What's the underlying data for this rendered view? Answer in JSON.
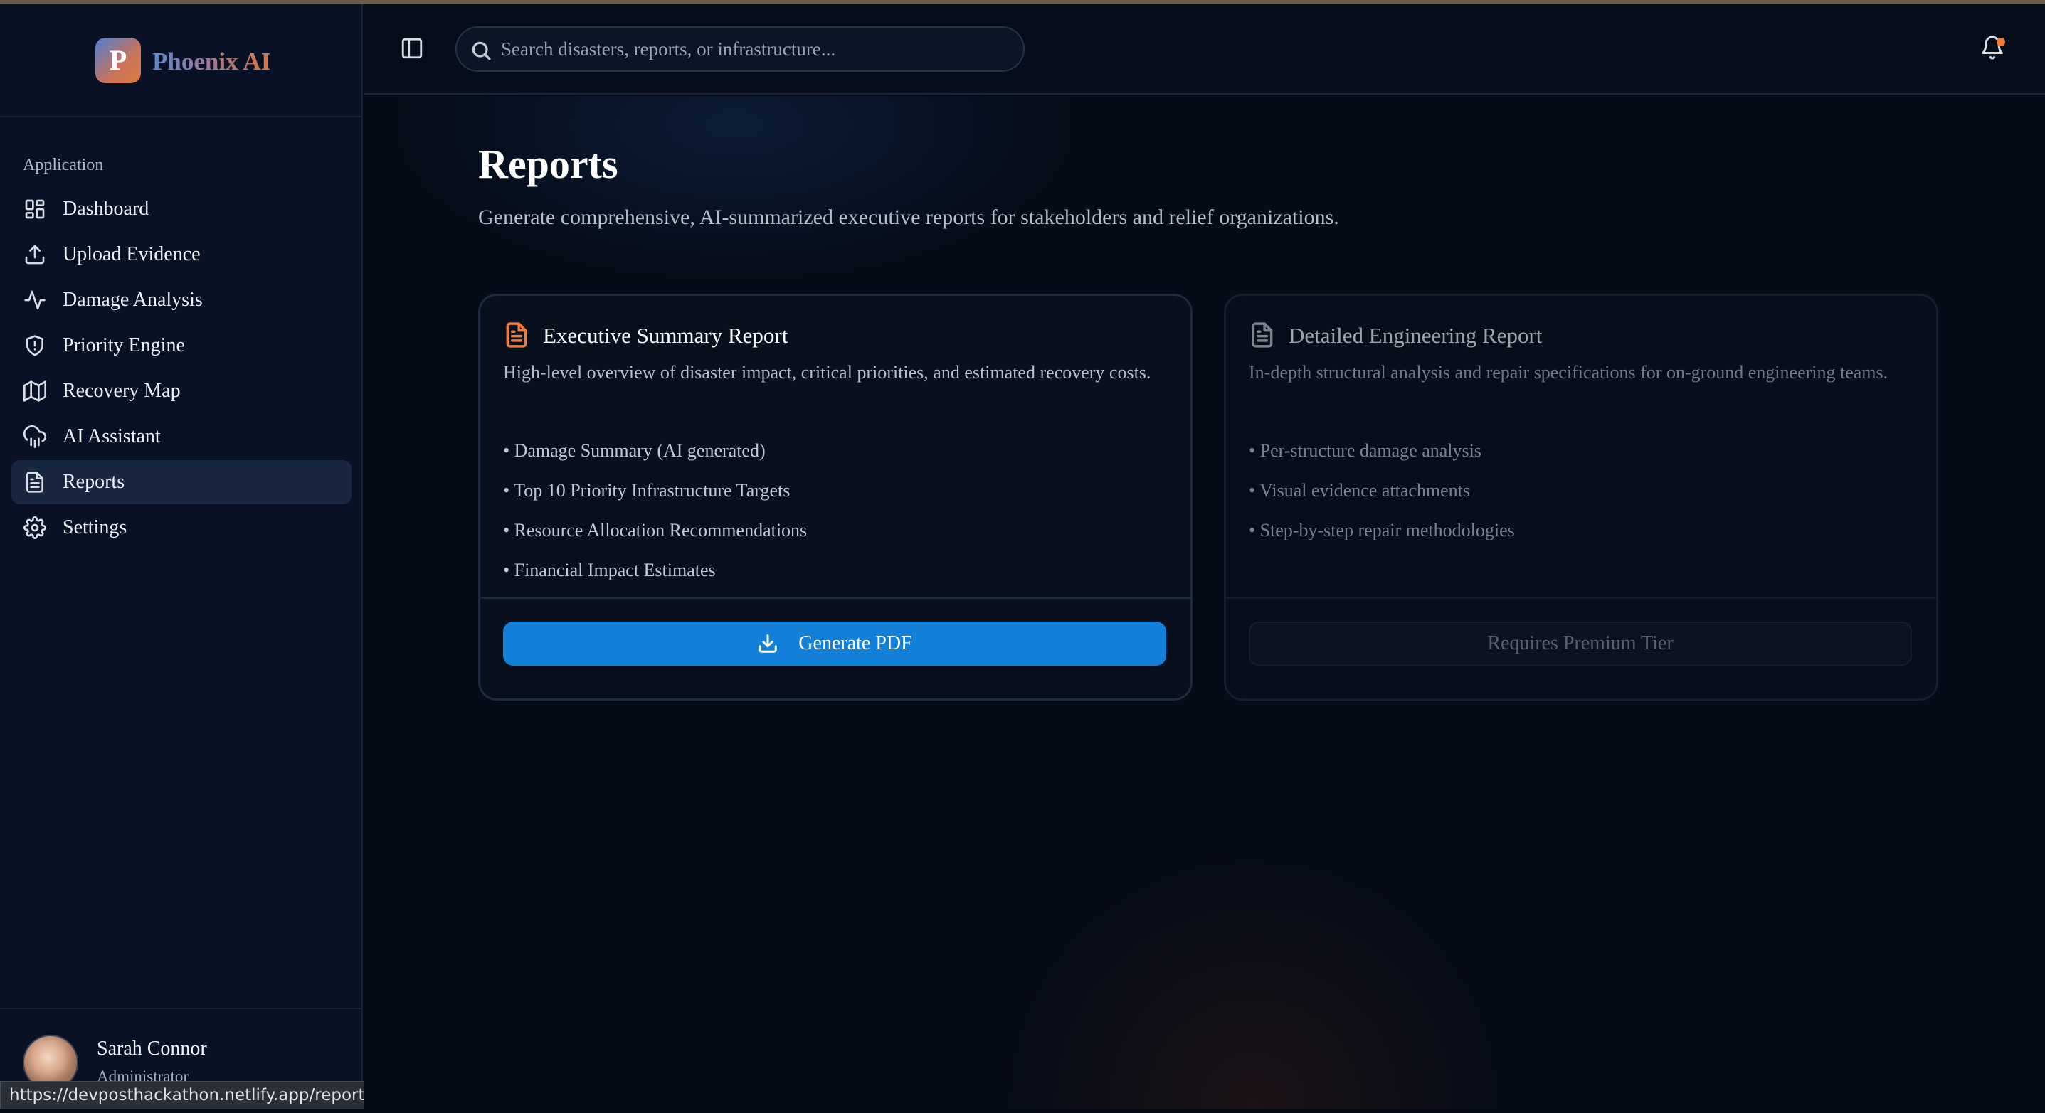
{
  "brand": {
    "logo_letter": "P",
    "name": "Phoenix AI"
  },
  "sidebar": {
    "section_label": "Application",
    "items": [
      {
        "label": "Dashboard",
        "icon": "dashboard-grid-icon"
      },
      {
        "label": "Upload Evidence",
        "icon": "upload-icon"
      },
      {
        "label": "Damage Analysis",
        "icon": "activity-icon"
      },
      {
        "label": "Priority Engine",
        "icon": "shield-icon"
      },
      {
        "label": "Recovery Map",
        "icon": "map-icon"
      },
      {
        "label": "AI Assistant",
        "icon": "cloud-rain-icon"
      },
      {
        "label": "Reports",
        "icon": "file-text-icon",
        "active": true
      },
      {
        "label": "Settings",
        "icon": "gear-icon"
      }
    ]
  },
  "user": {
    "name": "Sarah Connor",
    "role": "Administrator"
  },
  "status_bar": {
    "url": "https://devposthackathon.netlify.app/reports"
  },
  "header": {
    "search_placeholder": "Search disasters, reports, or infrastructure...",
    "notification_badge": true
  },
  "page": {
    "title": "Reports",
    "subtitle": "Generate comprehensive, AI-summarized executive reports for stakeholders and relief organizations."
  },
  "cards": [
    {
      "title": "Executive Summary Report",
      "description": "High-level overview of disaster impact, critical priorities, and estimated recovery costs.",
      "features": [
        "• Damage Summary (AI generated)",
        "• Top 10 Priority Infrastructure Targets",
        "• Resource Allocation Recommendations",
        "• Financial Impact Estimates"
      ],
      "button_label": "Generate PDF",
      "icon_color": "#f07c35"
    },
    {
      "title": "Detailed Engineering Report",
      "description": "In-depth structural analysis and repair specifications for on-ground engineering teams.",
      "features": [
        "• Per-structure damage analysis",
        "• Visual evidence attachments",
        "• Step-by-step repair methodologies"
      ],
      "button_label": "Requires Premium Tier",
      "icon_color": "#c9ced8"
    }
  ],
  "colors": {
    "accent": "#127fd8",
    "brand_orange": "#f07c35",
    "background": "#050b17"
  }
}
